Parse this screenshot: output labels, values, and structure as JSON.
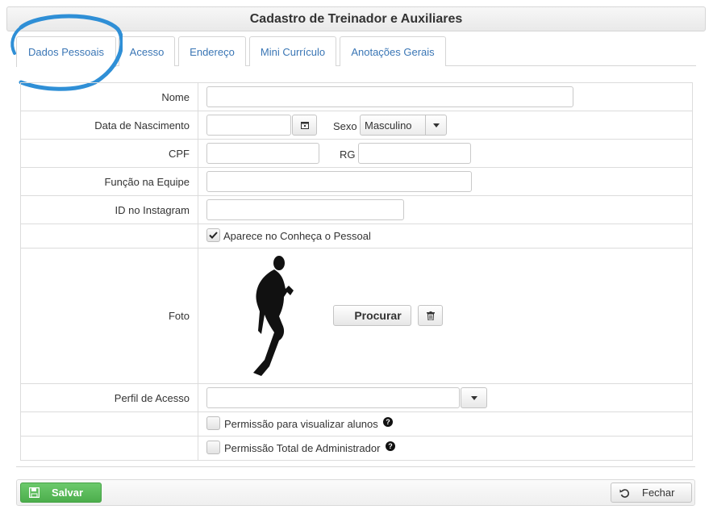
{
  "window": {
    "title": "Cadastro de Treinador e Auxiliares"
  },
  "tabs": [
    {
      "label": "Dados Pessoais",
      "active": true
    },
    {
      "label": "Acesso",
      "active": false
    },
    {
      "label": "Endereço",
      "active": false
    },
    {
      "label": "Mini Currículo",
      "active": false
    },
    {
      "label": "Anotações Gerais",
      "active": false
    }
  ],
  "form": {
    "nome": {
      "label": "Nome",
      "value": ""
    },
    "data_nascimento": {
      "label": "Data de Nascimento",
      "value": "",
      "calendar_icon": "calendar-icon"
    },
    "sexo": {
      "label": "Sexo",
      "value": "Masculino"
    },
    "cpf": {
      "label": "CPF",
      "value": ""
    },
    "rg": {
      "label": "RG",
      "value": ""
    },
    "funcao": {
      "label": "Função na Equipe",
      "value": ""
    },
    "instagram": {
      "label": "ID no Instagram",
      "value": ""
    },
    "aparece": {
      "label": "Aparece no Conheça o Pessoal",
      "checked": true
    },
    "foto": {
      "label": "Foto",
      "browse_label": "Procurar",
      "delete_icon": "trash-icon"
    },
    "perfil": {
      "label": "Perfil de Acesso",
      "value": ""
    },
    "perm_alunos": {
      "label": "Permissão para visualizar alunos",
      "checked": false
    },
    "perm_admin": {
      "label": "Permissão Total de Administrador",
      "checked": false
    }
  },
  "footer": {
    "save_label": "Salvar",
    "close_label": "Fechar"
  },
  "colors": {
    "accent": "#3a76b5",
    "highlight_circle": "#2f8fd6",
    "save": "#5cb85c"
  }
}
